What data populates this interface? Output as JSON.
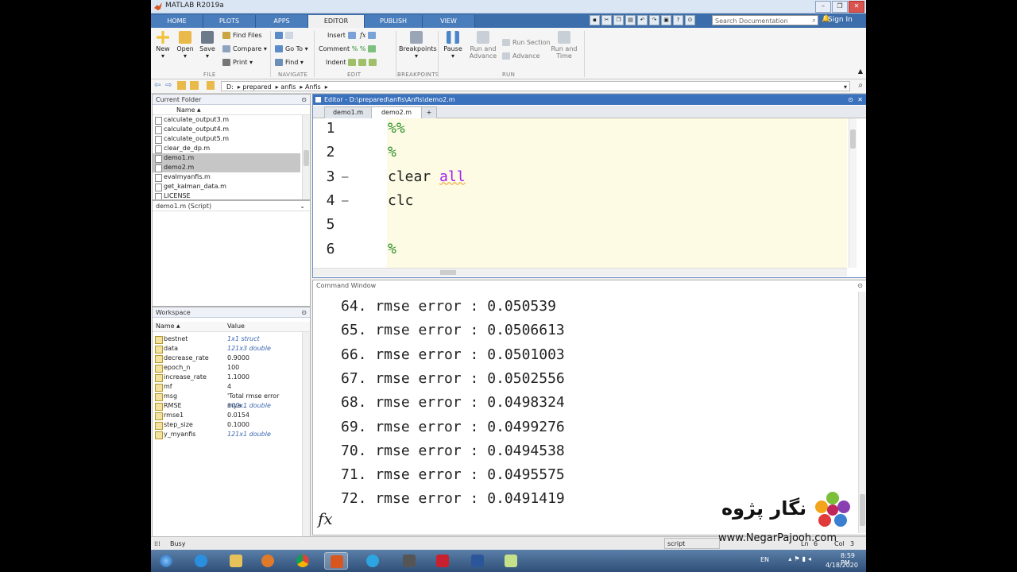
{
  "app": {
    "title": "MATLAB R2019a",
    "accent": "#3c6eab"
  },
  "ribbon_tabs": [
    "HOME",
    "PLOTS",
    "APPS",
    "EDITOR",
    "PUBLISH",
    "VIEW"
  ],
  "active_tab": "EDITOR",
  "search": {
    "placeholder": "Search Documentation"
  },
  "signin": "Sign In",
  "ribbon": {
    "file": {
      "new": "New",
      "open": "Open",
      "save": "Save",
      "find_files": "Find Files",
      "compare": "Compare",
      "print": "Print",
      "group": "FILE"
    },
    "navigate": {
      "goto": "Go To",
      "find": "Find",
      "group": "NAVIGATE"
    },
    "edit": {
      "insert": "Insert",
      "comment": "Comment",
      "indent": "Indent",
      "group": "EDIT"
    },
    "breakpoints": {
      "label": "Breakpoints",
      "group": "BREAKPOINTS"
    },
    "run": {
      "pause": "Pause",
      "run_and": "Run and",
      "advance1": "Advance",
      "run_section": "Run Section",
      "advance2": "Advance",
      "run_and2": "Run and",
      "time": "Time",
      "group": "RUN"
    }
  },
  "address": {
    "crumbs": [
      "D:",
      "prepared",
      "anfis",
      "Anfis"
    ]
  },
  "current_folder": {
    "title": "Current Folder",
    "col_name": "Name",
    "files": [
      {
        "name": "calculate_output3.m",
        "selected": false
      },
      {
        "name": "calculate_output4.m",
        "selected": false
      },
      {
        "name": "calculate_output5.m",
        "selected": false
      },
      {
        "name": "clear_de_dp.m",
        "selected": false
      },
      {
        "name": "demo1.m",
        "selected": true
      },
      {
        "name": "demo2.m",
        "selected": true
      },
      {
        "name": "evalmyanfis.m",
        "selected": false
      },
      {
        "name": "get_kalman_data.m",
        "selected": false
      },
      {
        "name": "LICENSE",
        "selected": false
      }
    ]
  },
  "details": {
    "title": "demo1.m  (Script)"
  },
  "workspace": {
    "title": "Workspace",
    "col_name": "Name",
    "col_value": "Value",
    "vars": [
      {
        "name": "bestnet",
        "value": "1x1 struct",
        "italic": true
      },
      {
        "name": "data",
        "value": "121x3 double",
        "italic": true
      },
      {
        "name": "decrease_rate",
        "value": "0.9000",
        "italic": false
      },
      {
        "name": "epoch_n",
        "value": "100",
        "italic": false
      },
      {
        "name": "increase_rate",
        "value": "1.1000",
        "italic": false
      },
      {
        "name": "mf",
        "value": "4",
        "italic": false
      },
      {
        "name": "msg",
        "value": "'Total rmse error mya...",
        "italic": false
      },
      {
        "name": "RMSE",
        "value": "100x1 double",
        "italic": true
      },
      {
        "name": "rmse1",
        "value": "0.0154",
        "italic": false
      },
      {
        "name": "step_size",
        "value": "0.1000",
        "italic": false
      },
      {
        "name": "y_myanfis",
        "value": "121x1 double",
        "italic": true
      }
    ]
  },
  "editor": {
    "title": "Editor - D:\\prepared\\anfis\\Anfis\\demo2.m",
    "tabs": [
      "demo1.m",
      "demo2.m"
    ],
    "active_tab": "demo2.m",
    "lines": [
      {
        "num": "1",
        "text": "%%",
        "type": "comment",
        "dash": false
      },
      {
        "num": "2",
        "text": "%",
        "type": "comment",
        "dash": false
      },
      {
        "num": "3",
        "text": "clear",
        "kw": "all",
        "type": "code",
        "dash": true
      },
      {
        "num": "4",
        "text": "clc",
        "type": "code",
        "dash": true
      },
      {
        "num": "5",
        "text": "",
        "type": "code",
        "dash": false
      },
      {
        "num": "6",
        "text": "%",
        "type": "comment",
        "dash": false
      }
    ]
  },
  "command_window": {
    "title": "Command Window",
    "lines": [
      "64. rmse error : 0.050539",
      "65. rmse error : 0.0506613",
      "66. rmse error : 0.0501003",
      "67. rmse error : 0.0502556",
      "68. rmse error : 0.0498324",
      "69. rmse error : 0.0499276",
      "70. rmse error : 0.0494538",
      "71. rmse error : 0.0495575",
      "72. rmse error : 0.0491419"
    ],
    "prompt": "fx"
  },
  "status": {
    "busy": "Busy",
    "mode": "script",
    "ln": "Ln",
    "ln_val": "6",
    "col": "Col",
    "col_val": "3"
  },
  "taskbar": {
    "lang": "EN",
    "time": "8:59 PM",
    "date": "4/18/2020"
  },
  "watermark": {
    "text": "نگار پژوه",
    "url": "www.NegarPajooh.com"
  }
}
